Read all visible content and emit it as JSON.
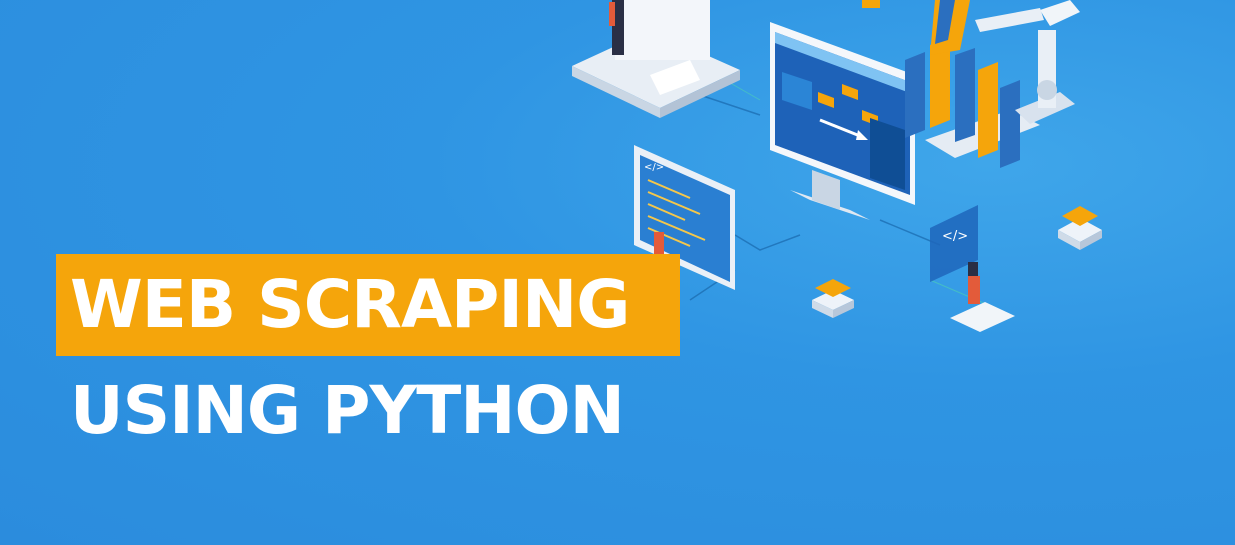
{
  "colors": {
    "background": "#2f95e3",
    "accent": "#f5a50b",
    "title_text": "#ffffff"
  },
  "title": {
    "line1": "WEB SCRAPING",
    "line2": "USING PYTHON"
  },
  "illustration": {
    "code_glyph": "</>"
  }
}
